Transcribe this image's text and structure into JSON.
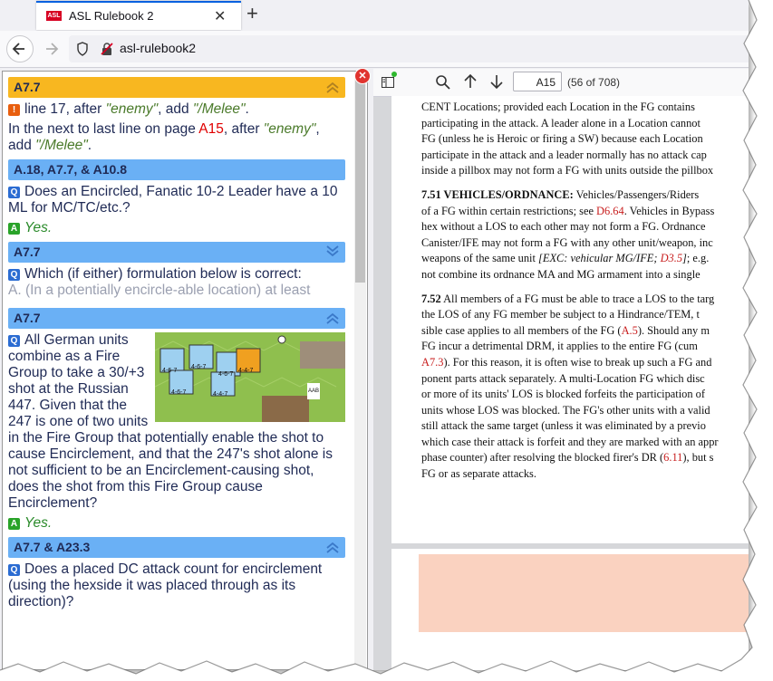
{
  "browser": {
    "tab_title": "ASL Rulebook 2",
    "tab_favicon_text": "ASL",
    "url": "asl-rulebook2"
  },
  "left_panel": {
    "entries": [
      {
        "header": "A7.7",
        "header_color": "#f8b720",
        "lines": [
          {
            "prefix": "line 17, after ",
            "q1": "\"enemy\"",
            "mid": ", add ",
            "q2": "\"/Melee\"",
            "end": "."
          },
          {
            "prefix": "In the next to last line on page ",
            "ref": "A15",
            "mid": ", after ",
            "q1": "\"enemy\"",
            "mid2": ", add ",
            "q2": "\"/Melee\"",
            "end": "."
          }
        ]
      },
      {
        "header": "A.18, A7.7, & A10.8",
        "question": "Does an Encircled, Fanatic 10-2 Leader have a 10 ML for MC/TC/etc.?",
        "answer": "Yes."
      },
      {
        "header": "A7.7",
        "question": "Which (if either) formulation below is correct:",
        "question_cont": "A. (In a potentially encircle-able location) at least"
      },
      {
        "header": "A7.7",
        "question": "All German units combine as a Fire Group to take a 30/+3 shot at the Russian 447. Given that the 247 is one of two units in the Fire Group that potentially enable the shot to cause Encirclement, and that the 247's shot alone is not sufficient to be an Encirclement-causing shot, does the shot from this Fire Group cause Encirclement?",
        "answer": "Yes.",
        "counters": [
          "4-6-7",
          "4-6-7",
          "4-6-7",
          "4-4-7",
          "4-6-7",
          "4-4-7",
          "AAB"
        ]
      },
      {
        "header": "A7.7 & A23.3",
        "question": "Does a placed DC attack count for encirclement (using the hexside it was placed through as its direction)?"
      }
    ]
  },
  "viewer": {
    "page_input": "A15",
    "page_count": "(56 of 708)"
  },
  "pdf_lines": {
    "p1": [
      "CENT Locations; provided each Location in the FG contains",
      "participating in the attack. A leader alone in a Location cannot",
      "FG (unless he is Heroic or firing a SW) because each Location",
      "participate in the attack and a leader normally has no attack cap",
      "inside a pillbox may not form a FG with units outside the pillbox"
    ],
    "p2_head": "7.51 VEHICLES/ORDNANCE:",
    "p2_l1_rest": " Vehicles/Passengers/Riders",
    "p2_l2a": "of a FG within certain restrictions; see ",
    "p2_l2_ref": "D6.64",
    "p2_l2b": ". Vehicles in Bypass",
    "p2_l3": "hex without a LOS to each other may not form a FG. Ordnance",
    "p2_l4": "Canister/IFE may not form a FG with any other unit/weapon, inc",
    "p2_l5a": "weapons of the same unit ",
    "p2_l5_it": "[EXC: vehicular MG/IFE; ",
    "p2_l5_ref": "D3.5",
    "p2_l5_it2": "]",
    "p2_l5b": "; e.g.",
    "p2_l6": "not combine its ordnance MA and MG armament into a single",
    "p3_head": "7.52",
    "p3_l1_rest": " All members of a FG must be able to trace a LOS to the targ",
    "p3_l2": "the LOS of any FG member be subject to a Hindrance/TEM, t",
    "p3_l3a": "sible case applies to all members of the FG (",
    "p3_l3_ref": "A.5",
    "p3_l3b": "). Should any m",
    "p3_l4": "FG incur a detrimental DRM, it applies to the entire FG (cum",
    "p3_l5_ref": "A7.3",
    "p3_l5b": "). For this reason, it is often wise to break up such a FG and",
    "p3_l6": "ponent parts attack separately. A multi-Location FG which disc",
    "p3_l7": "or more of its units' LOS is blocked forfeits the participation of",
    "p3_l8": "units whose LOS was blocked. The FG's other units with a valid",
    "p3_l9": "still attack the same target (unless it was eliminated by a previo",
    "p3_l10": "which case their attack is forfeit and they are marked with an appr",
    "p3_l11a": "phase counter) after resolving the blocked firer's DR (",
    "p3_l11_ref": "6.11",
    "p3_l11b": "), but s",
    "p3_l12": "FG or as separate attacks."
  }
}
